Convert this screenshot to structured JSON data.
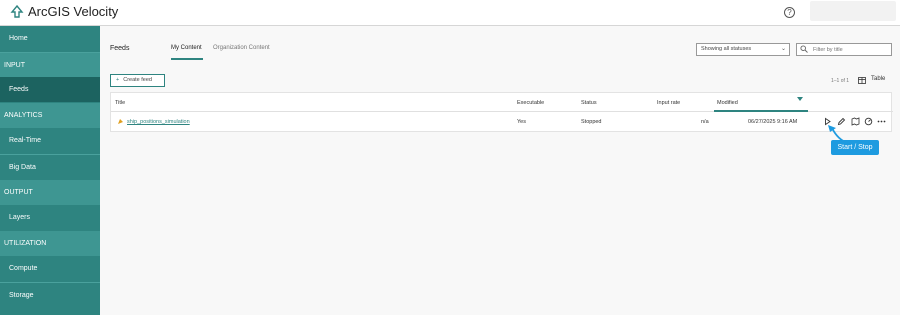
{
  "app": {
    "title": "ArcGIS Velocity",
    "help_icon": "question-circle-icon",
    "help_glyph": "?",
    "logo_icon": "velocity-logo-icon"
  },
  "sidebar": {
    "items": [
      {
        "label": "Home",
        "kind": "item"
      },
      {
        "label": "INPUT",
        "kind": "section"
      },
      {
        "label": "Feeds",
        "kind": "item",
        "active": true
      },
      {
        "label": "ANALYTICS",
        "kind": "section"
      },
      {
        "label": "Real-Time",
        "kind": "item"
      },
      {
        "label": "Big Data",
        "kind": "item"
      },
      {
        "label": "OUTPUT",
        "kind": "section"
      },
      {
        "label": "Layers",
        "kind": "item"
      },
      {
        "label": "UTILIZATION",
        "kind": "section"
      },
      {
        "label": "Compute",
        "kind": "item"
      },
      {
        "label": "Storage",
        "kind": "item"
      }
    ]
  },
  "main": {
    "title": "Feeds",
    "tabs": [
      {
        "label": "My Content",
        "active": true
      },
      {
        "label": "Organization Content",
        "active": false
      }
    ],
    "status_filter": {
      "selected": "Showing all statuses"
    },
    "search": {
      "placeholder": "Filter by title"
    },
    "create_button": {
      "label": "Create feed",
      "icon": "+"
    },
    "pager": "1–1 of 1",
    "view_toggle": {
      "label": "Table",
      "icon": "table-icon"
    }
  },
  "table": {
    "columns": [
      "Title",
      "Executable",
      "Status",
      "Input rate",
      "Modified"
    ],
    "sorted_column": "Modified",
    "rows": [
      {
        "title": "ship_positions_simulation",
        "executable": "Yes",
        "status": "Stopped",
        "input_rate": "n/a",
        "modified": "06/27/2025 9:16 AM"
      }
    ],
    "row_actions": [
      "play-icon",
      "edit-pencil-icon",
      "clone-icon",
      "details-icon",
      "more-ellipsis-icon"
    ]
  },
  "callout": {
    "label": "Start / Stop"
  },
  "colors": {
    "brand_teal": "#2e8480",
    "sidebar_section": "#3e9692",
    "sidebar_active": "#1c6360",
    "callout_blue": "#1e9be0"
  }
}
